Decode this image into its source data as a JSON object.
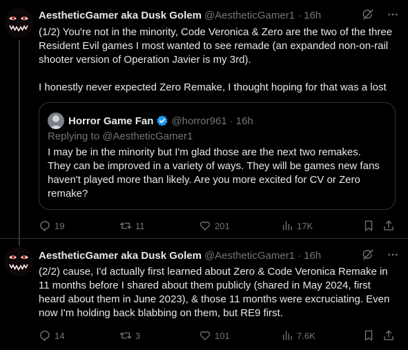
{
  "tweets": [
    {
      "author_name": "AestheticGamer aka Dusk Golem",
      "handle": "@AestheticGamer1",
      "separator": "·",
      "time": "16h",
      "text": "(1/2) You're not in the minority, Code Veronica & Zero are the two of the three Resident Evil games I most wanted to see remade (an expanded non-on-rail shooter version of Operation Javier is my 3rd).\n\nI honestly never expected Zero Remake, I thought hoping for that was a lost",
      "quote": {
        "author_name": "Horror Game Fan",
        "handle": "@horror961",
        "separator": "·",
        "time": "16h",
        "replying_to": "Replying to @AestheticGamer1",
        "text": "I may be in the minority but I'm glad those are the next two remakes. They can be improved in a variety of ways. They will be games new fans haven't played more than likely. Are you more excited for CV or Zero remake?"
      },
      "stats": {
        "replies": "19",
        "reposts": "11",
        "likes": "201",
        "views": "17K"
      }
    },
    {
      "author_name": "AestheticGamer aka Dusk Golem",
      "handle": "@AestheticGamer1",
      "separator": "·",
      "time": "16h",
      "text": "(2/2) cause, I'd actually first learned about Zero & Code Veronica Remake in 11 months before I shared about them publicly (shared in May 2024, first heard about them in June 2023), & those 11 months were excruciating. Even now I'm holding back blabbing on them, but RE9 first.",
      "stats": {
        "replies": "14",
        "reposts": "3",
        "likes": "101",
        "views": "7.6K"
      }
    }
  ],
  "colors": {
    "background": "#000000",
    "text": "#e7e9ea",
    "secondary": "#71767b",
    "border": "#2f3336",
    "verified": "#1d9bf0"
  },
  "icons": [
    "grok-icon",
    "more-icon",
    "reply-icon",
    "repost-icon",
    "like-icon",
    "views-icon",
    "bookmark-icon",
    "share-icon",
    "verified-badge-icon"
  ]
}
